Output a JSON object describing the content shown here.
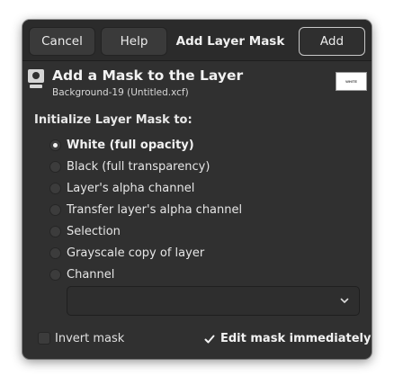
{
  "headerbar": {
    "cancel_label": "Cancel",
    "help_label": "Help",
    "title": "Add Layer Mask",
    "add_label": "Add"
  },
  "dialog": {
    "title": "Add a Mask to the Layer",
    "subtitle": "Background-19 (Untitled.xcf)",
    "preview_text": "WHITE"
  },
  "init": {
    "label": "Initialize Layer Mask to:",
    "options": [
      {
        "label": "White (full opacity)",
        "checked": true
      },
      {
        "label": "Black (full transparency)",
        "checked": false
      },
      {
        "label": "Layer's alpha channel",
        "checked": false
      },
      {
        "label": "Transfer layer's alpha channel",
        "checked": false
      },
      {
        "label": "Selection",
        "checked": false
      },
      {
        "label": "Grayscale copy of layer",
        "checked": false
      },
      {
        "label": "Channel",
        "checked": false
      }
    ]
  },
  "channel_combo": {
    "value": ""
  },
  "options": {
    "invert_label": "Invert mask",
    "invert_checked": false,
    "edit_label": "Edit mask immediately",
    "edit_checked": true
  },
  "icons": {
    "dialog_icon": "layer-mask-icon",
    "combo_arrow": "chevron-down-icon",
    "check": "check-icon"
  },
  "colors": {
    "dialog_bg": "#303030",
    "headerbar_bg": "#2b2b2b",
    "text": "#e6e6e6"
  }
}
